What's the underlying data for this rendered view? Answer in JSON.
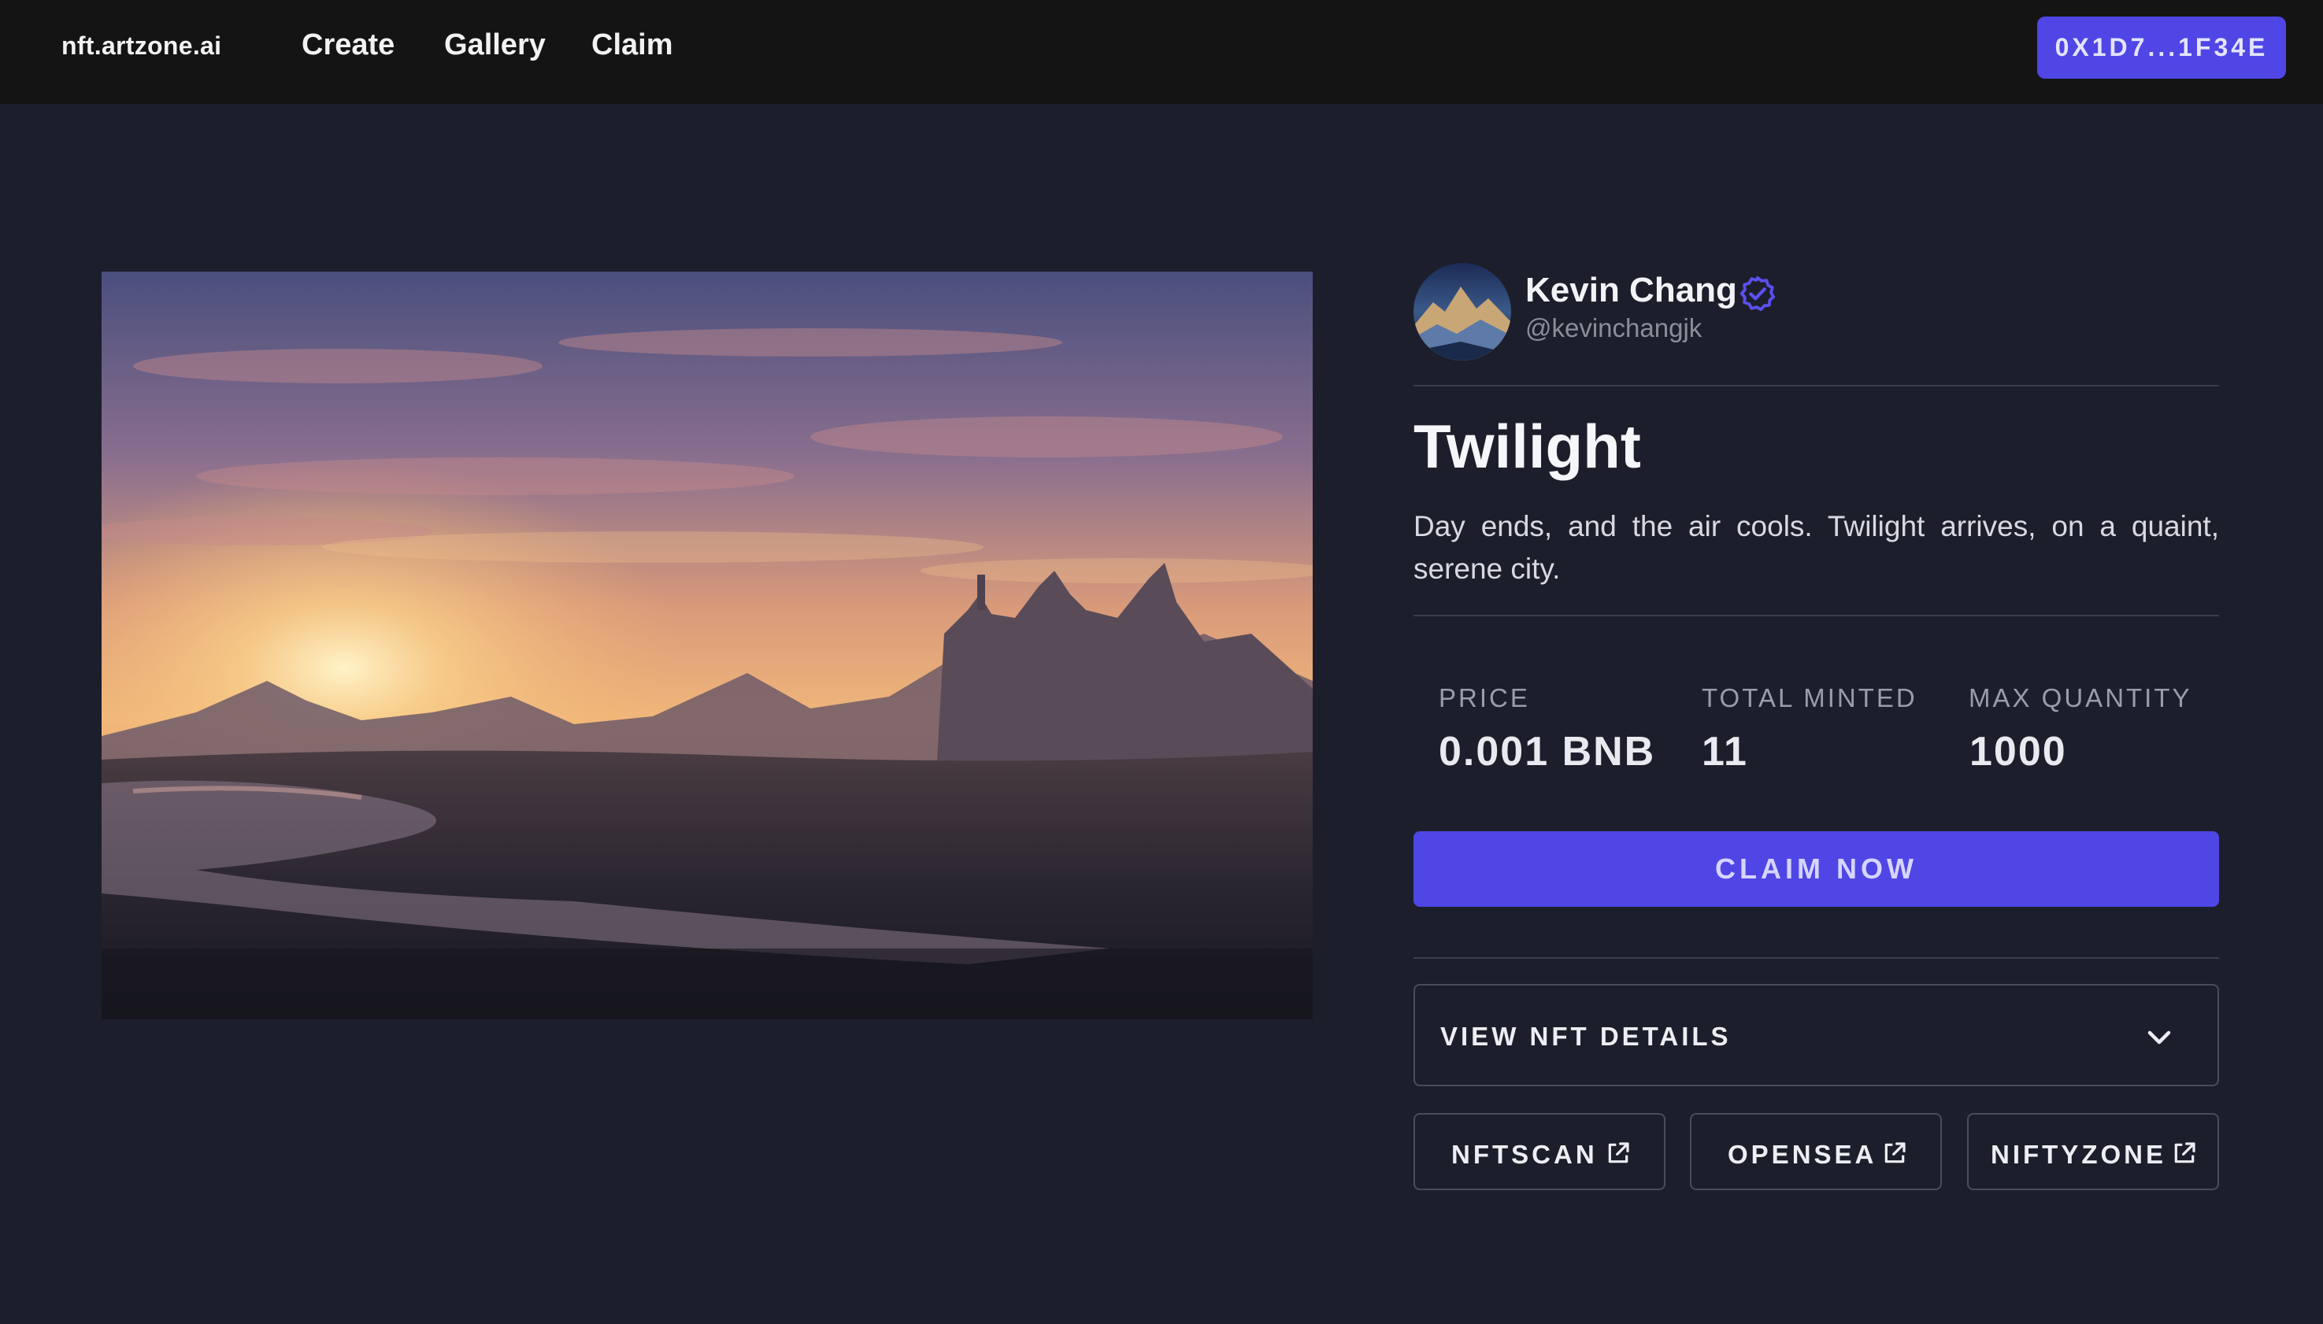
{
  "nav": {
    "brand": "nft.artzone.ai",
    "links": [
      "Create",
      "Gallery",
      "Claim"
    ],
    "wallet_label": "0X1D7...1F34E"
  },
  "creator": {
    "name": "Kevin Chang",
    "handle": "@kevinchangjk",
    "verified": true
  },
  "nft": {
    "title": "Twilight",
    "description": "Day ends, and the air cools. Twilight arrives, on a quaint, serene city."
  },
  "stats": [
    {
      "label": "PRICE",
      "value": "0.001 BNB"
    },
    {
      "label": "TOTAL MINTED",
      "value": "11"
    },
    {
      "label": "MAX QUANTITY",
      "value": "1000"
    }
  ],
  "actions": {
    "claim_label": "CLAIM NOW",
    "details_label": "VIEW NFT DETAILS",
    "external_links": [
      "NFTSCAN",
      "OPENSEA",
      "NIFTYZONE"
    ]
  },
  "icons": {
    "verified": "verified-badge-icon",
    "details_toggle": "chevron-down-icon",
    "external": "external-link-icon"
  },
  "colors": {
    "accent": "#4f46e5",
    "background": "#1c1f2b",
    "topbar": "#141414",
    "border": "#4a4d59"
  }
}
